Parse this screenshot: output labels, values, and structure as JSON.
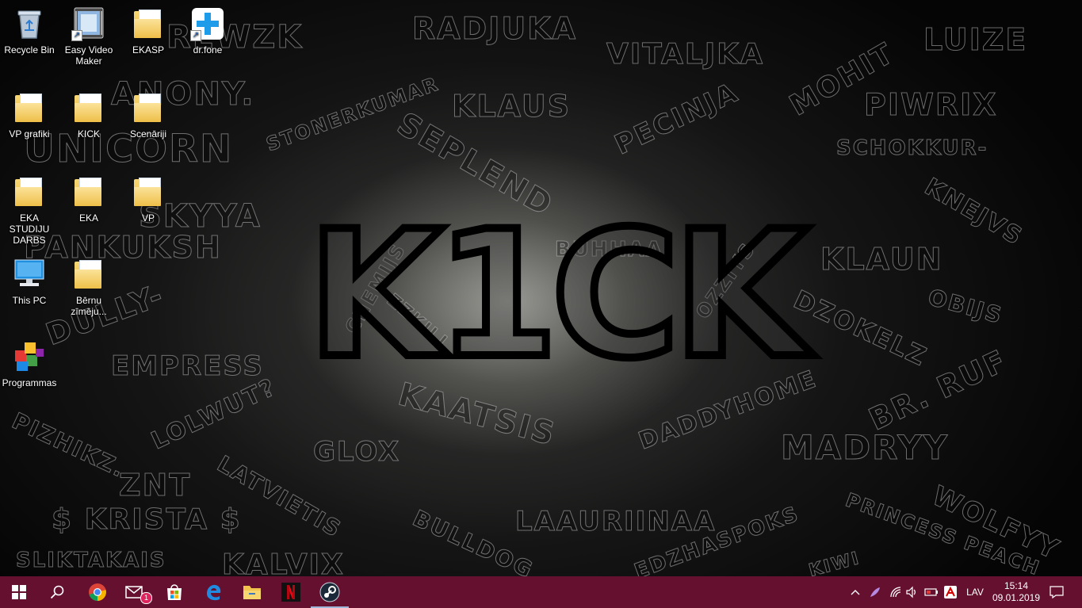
{
  "wallpaper": {
    "logo": "K1CK",
    "names": [
      "RADJUKA",
      "VITALJKA",
      "LUIZE",
      "REWZK",
      "ANONY.",
      "MOHIT",
      "PIWRIX",
      "KLAUS",
      "STONERKUMAR",
      "PECINJA",
      "SCHOKKUR-",
      "UNICORN",
      "SEPLEND",
      "KNEJVS",
      "SKYYA",
      "PANKUKSH",
      "BUHHAA",
      "KLAUN",
      "CHEMIJS",
      "OZZIYS",
      "OBIJS",
      "DULLY-",
      "ZZKILL",
      "DZOKELZ",
      "EMPRESS",
      "BR. RUF",
      "LOLWUT?",
      "KAATSIS",
      "DADDYHOME",
      "MADRYY",
      "PIZHIKZ.",
      "GLOX",
      "ZNT",
      "LATVIETIS",
      "WOLFYY",
      "$ KRISTA $",
      "LAAURIINAA",
      "PRINCESS PEACH",
      "BULLDOG",
      "SLIKTAKAIS",
      "KALVIX",
      "EDZHASPOKS",
      "KIWI"
    ]
  },
  "desktop_icons": [
    {
      "label": "Recycle Bin",
      "icon": "recycle-bin-icon"
    },
    {
      "label": "Easy Video Maker",
      "icon": "video-maker-icon"
    },
    {
      "label": "EKASP",
      "icon": "folder-icon"
    },
    {
      "label": "dr.fone",
      "icon": "drfone-icon"
    },
    {
      "label": "VP grafiki",
      "icon": "folder-icon"
    },
    {
      "label": "KICK",
      "icon": "folder-icon"
    },
    {
      "label": "Scenāriji",
      "icon": "folder-icon"
    },
    {
      "label": "EKA STUDIJU DARBS",
      "icon": "folder-icon"
    },
    {
      "label": "EKA",
      "icon": "folder-icon"
    },
    {
      "label": "VP",
      "icon": "folder-icon"
    },
    {
      "label": "This PC",
      "icon": "computer-icon"
    },
    {
      "label": "Bērnu zīmēju...",
      "icon": "folder-icon"
    },
    {
      "label": "Programmas",
      "icon": "programs-icon"
    }
  ],
  "taskbar": {
    "apps": [
      "start-icon",
      "search-icon",
      "chrome-icon",
      "mail-icon",
      "store-icon",
      "edge-icon",
      "file-explorer-icon",
      "netflix-icon",
      "steam-icon"
    ],
    "mail_badge": "1",
    "language": "LAV",
    "time": "15:14",
    "date": "09.01.2019",
    "colors": {
      "taskbar": "#64102e",
      "accent": "#0078d7"
    }
  }
}
